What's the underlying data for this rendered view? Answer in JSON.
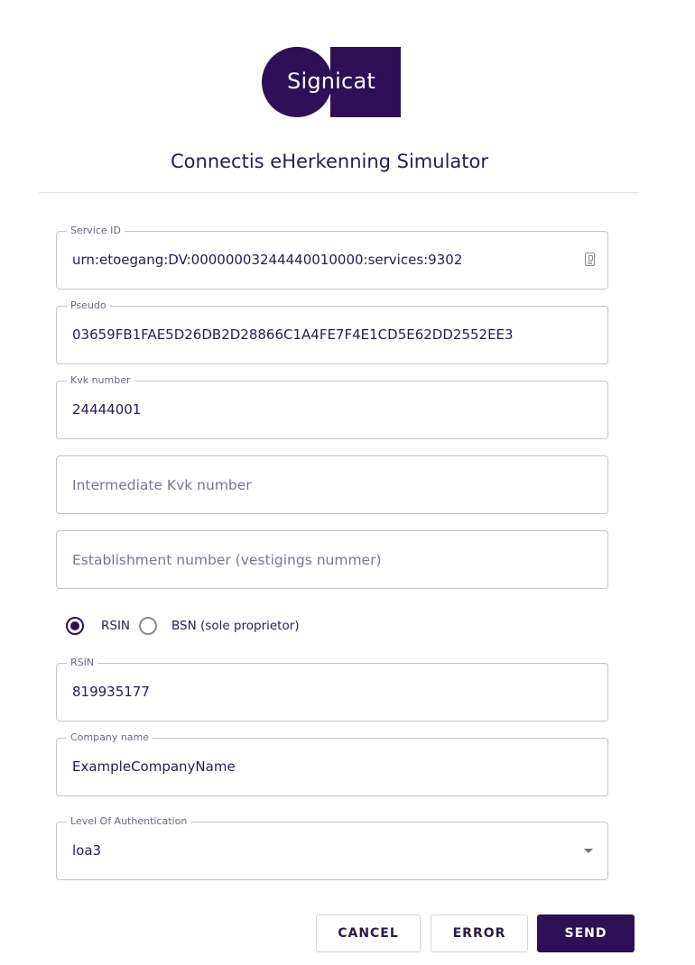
{
  "brand": {
    "logo_text": "Signicat",
    "color": "#2d1055"
  },
  "page": {
    "title": "Connectis eHerkenning Simulator"
  },
  "form": {
    "service_id": {
      "label": "Service ID",
      "value": "urn:etoegang:DV:00000003244440010000:services:9302",
      "icon": "id-card-icon"
    },
    "pseudo": {
      "label": "Pseudo",
      "value": "03659FB1FAE5D26DB2D28866C1A4FE7F4E1CD5E62DD2552EE3"
    },
    "kvk_number": {
      "label": "Kvk number",
      "value": "24444001"
    },
    "intermediate_kvk": {
      "placeholder": "Intermediate Kvk number"
    },
    "establishment_number": {
      "placeholder": "Establishment number (vestigings nummer)"
    },
    "identifier_type": {
      "options": [
        {
          "label": "RSIN",
          "selected": true
        },
        {
          "label": "BSN (sole proprietor)",
          "selected": false
        }
      ]
    },
    "rsin": {
      "label": "RSIN",
      "value": "819935177"
    },
    "company_name": {
      "label": "Company name",
      "value": "ExampleCompanyName"
    },
    "level_of_authentication": {
      "label": "Level Of Authentication",
      "value": "loa3",
      "icon": "caret-down-icon"
    }
  },
  "actions": {
    "cancel": "CANCEL",
    "error": "ERROR",
    "send": "SEND"
  }
}
